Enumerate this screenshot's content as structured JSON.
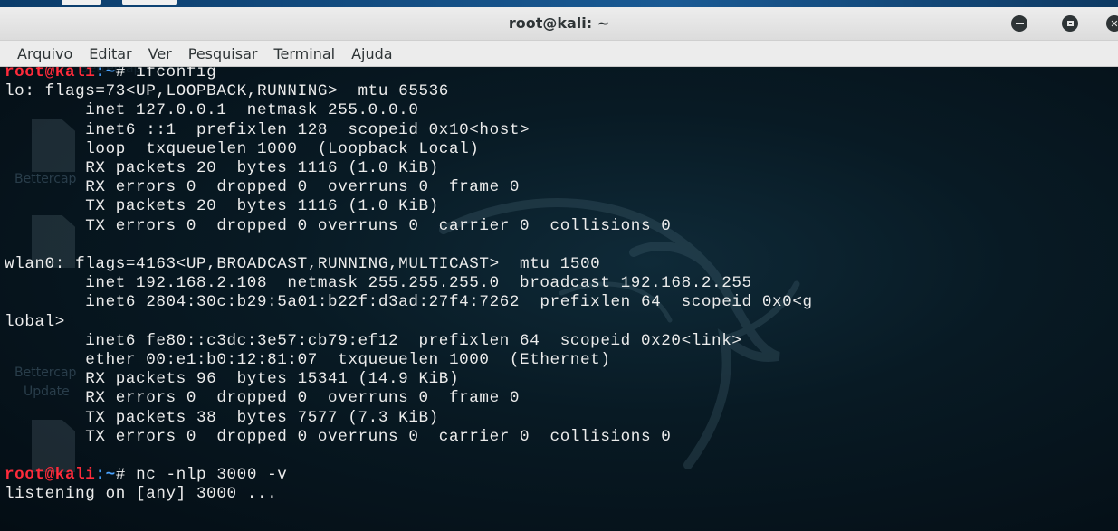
{
  "window": {
    "title": "root@kali: ~",
    "close_glyph": "✕"
  },
  "menu": [
    "Arquivo",
    "Editar",
    "Ver",
    "Pesquisar",
    "Terminal",
    "Ajuda"
  ],
  "desktop_labels": {
    "ghost_top": "Bettercap",
    "bettercap_1": "Bettercap",
    "bettercap_2": "Bettercap",
    "update": "Update"
  },
  "terminal": {
    "prompt_user": "root@kali",
    "prompt_path": ":~",
    "prompt_symbol": "# ",
    "command_1": "ifconfig",
    "output_1": [
      "lo: flags=73<UP,LOOPBACK,RUNNING>  mtu 65536",
      "        inet 127.0.0.1  netmask 255.0.0.0",
      "        inet6 ::1  prefixlen 128  scopeid 0x10<host>",
      "        loop  txqueuelen 1000  (Loopback Local)",
      "        RX packets 20  bytes 1116 (1.0 KiB)",
      "        RX errors 0  dropped 0  overruns 0  frame 0",
      "        TX packets 20  bytes 1116 (1.0 KiB)",
      "        TX errors 0  dropped 0 overruns 0  carrier 0  collisions 0",
      "",
      "wlan0: flags=4163<UP,BROADCAST,RUNNING,MULTICAST>  mtu 1500",
      "        inet 192.168.2.108  netmask 255.255.255.0  broadcast 192.168.2.255",
      "        inet6 2804:30c:b29:5a01:b22f:d3ad:27f4:7262  prefixlen 64  scopeid 0x0<g",
      "lobal>",
      "        inet6 fe80::c3dc:3e57:cb79:ef12  prefixlen 64  scopeid 0x20<link>",
      "        ether 00:e1:b0:12:81:07  txqueuelen 1000  (Ethernet)",
      "        RX packets 96  bytes 15341 (14.9 KiB)",
      "        RX errors 0  dropped 0  overruns 0  frame 0",
      "        TX packets 38  bytes 7577 (7.3 KiB)",
      "        TX errors 0  dropped 0 overruns 0  carrier 0  collisions 0",
      ""
    ],
    "command_2": "nc -nlp 3000 -v",
    "output_2": "listening on [any] 3000 ..."
  }
}
